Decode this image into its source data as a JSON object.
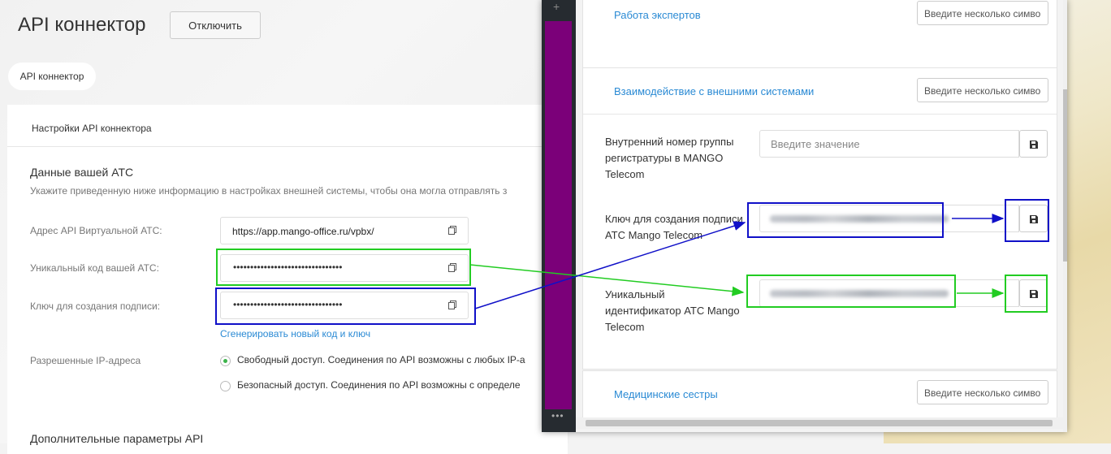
{
  "left": {
    "title": "API коннектор",
    "disable_button": "Отключить",
    "tab": "API коннектор",
    "card_header": "Настройки API коннектора",
    "section_title": "Данные вашей АТС",
    "section_desc": "Укажите приведенную ниже информацию в настройках внешней системы, чтобы она могла отправлять з",
    "fields": [
      {
        "label": "Адрес API Виртуальной АТС:",
        "value": "https://app.mango-office.ru/vpbx/"
      },
      {
        "label": "Уникальный код вашей АТС:",
        "value": "••••••••••••••••••••••••••••••••"
      },
      {
        "label": "Ключ для создания подписи:",
        "value": "••••••••••••••••••••••••••••••••"
      }
    ],
    "generate_link": "Сгенерировать новый код и ключ",
    "ip_label": "Разрешенные IP-адреса",
    "radio_free": "Свободный доступ. Соединения по API возможны с любых IP-а",
    "radio_safe": "Безопасный доступ. Соединения по API возможны с определе",
    "section2_title": "Дополнительные параметры API"
  },
  "right": {
    "group_experts": "Работа экспертов",
    "group_external": "Взаимодействие с внешними системами",
    "group_nurses": "Медицинские сестры",
    "search_placeholder": "Введите несколько симво",
    "fields": [
      {
        "label": "Внутренний номер группы регистратуры в MANGO Telecom",
        "placeholder": "Введите значение"
      },
      {
        "label": "Ключ для создания подписи АТС Mango Telecom"
      },
      {
        "label": "Уникальный идентификатор АТС Mango Telecom"
      }
    ]
  },
  "colors": {
    "link": "#2a8ad4",
    "annotation_green": "#22cc22",
    "annotation_blue": "#1010c8",
    "strip": "#7b0079"
  }
}
